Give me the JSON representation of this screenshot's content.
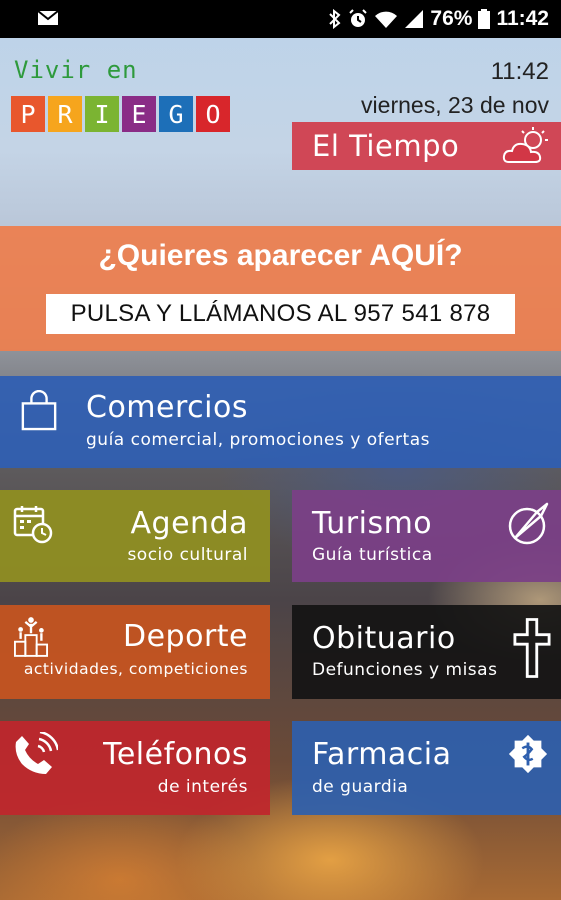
{
  "status_bar": {
    "battery": "76%",
    "time": "11:42"
  },
  "header": {
    "logo_text_top": "Vivir en",
    "logo_letters": [
      {
        "letter": "P",
        "color": "#e8572d"
      },
      {
        "letter": "R",
        "color": "#f6a51d"
      },
      {
        "letter": "I",
        "color": "#7bb432"
      },
      {
        "letter": "E",
        "color": "#8a2c86"
      },
      {
        "letter": "G",
        "color": "#1d6fb8"
      },
      {
        "letter": "O",
        "color": "#d8262b"
      }
    ],
    "clock": "11:42",
    "date": "viernes, 23 de nov",
    "weather_label": "El Tiempo",
    "weather_icon": "partly-cloudy-icon"
  },
  "promo": {
    "title": "¿Quieres aparecer AQUÍ?",
    "button": "PULSA Y LLÁMANOS AL 957 541 878"
  },
  "menu": {
    "comercios": {
      "title": "Comercios",
      "subtitle": "guía comercial, promociones y ofertas",
      "icon": "shopping-bag-icon",
      "color": "#2f5fb3"
    },
    "agenda": {
      "title": "Agenda",
      "subtitle": "socio cultural",
      "icon": "calendar-clock-icon",
      "color": "#8f8e22"
    },
    "turismo": {
      "title": "Turismo",
      "subtitle": "Guía turística",
      "icon": "compass-icon",
      "color": "#7b3f86"
    },
    "deporte": {
      "title": "Deporte",
      "subtitle": "actividades, competiciones",
      "icon": "podium-icon",
      "color": "#c8551f"
    },
    "obituario": {
      "title": "Obituario",
      "subtitle": "Defunciones y misas",
      "icon": "cross-icon",
      "color": "#141414"
    },
    "telefonos": {
      "title": "Teléfonos",
      "subtitle": "de interés",
      "icon": "phone-icon",
      "color": "#c0262c"
    },
    "farmacia": {
      "title": "Farmacia",
      "subtitle": "de guardia",
      "icon": "pharmacy-icon",
      "color": "#2e5fae"
    }
  }
}
